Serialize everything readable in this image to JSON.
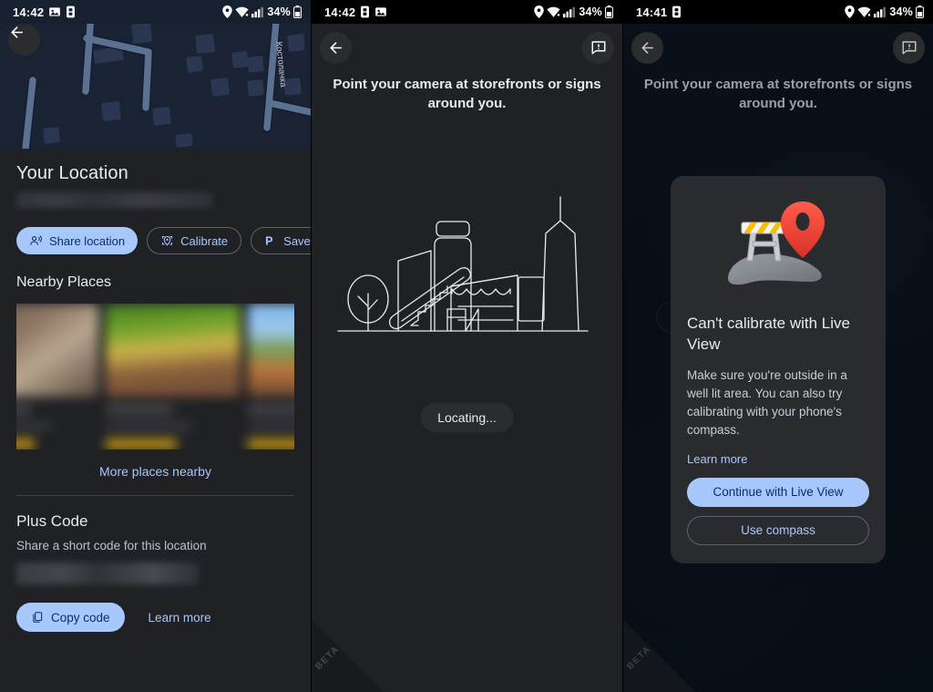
{
  "panels": {
    "location": {
      "status": {
        "time": "14:42",
        "icons": [
          "photo-icon",
          "sim-card-icon",
          "location-pin-icon",
          "wifi-icon",
          "signal-icon",
          "battery-icon"
        ],
        "battery": "34%"
      },
      "map": {
        "street_label": "Костолачка",
        "back_icon": "back-arrow-icon"
      },
      "title": "Your Location",
      "address_redacted": true,
      "chips": [
        {
          "label": "Share location",
          "icon": "share-location-icon",
          "style": "filled"
        },
        {
          "label": "Calibrate",
          "icon": "calibrate-compass-icon",
          "style": "outline"
        },
        {
          "label": "Save parl",
          "icon": "parking-p-icon",
          "style": "outline"
        }
      ],
      "nearby_title": "Nearby Places",
      "nearby_cards": [
        {
          "redacted": true,
          "has_rating": true
        },
        {
          "redacted": true,
          "has_rating": true
        },
        {
          "redacted": true,
          "has_rating": true
        }
      ],
      "more_link": "More places nearby",
      "plus_code": {
        "title": "Plus Code",
        "subtitle": "Share a short code for this location",
        "code_redacted": true,
        "copy_label": "Copy code",
        "copy_icon": "copy-icon",
        "learn_more": "Learn more"
      }
    },
    "live_view": {
      "status": {
        "time": "14:42",
        "battery": "34%"
      },
      "back_icon": "back-arrow-icon",
      "feedback_icon": "feedback-icon",
      "hint": "Point your camera at storefronts or signs around you.",
      "illustration": "city-street-line-art",
      "locating_label": "Locating...",
      "watermark": "BETA"
    },
    "calibrate_dialog": {
      "status": {
        "time": "14:41",
        "battery": "34%"
      },
      "back_icon": "back-arrow-icon",
      "feedback_icon": "feedback-icon",
      "hint": "Point your camera at storefronts or signs around you.",
      "dialog": {
        "illustration": "road-closed-pin-illustration",
        "title": "Can't calibrate with Live View",
        "body": "Make sure you're outside in a well lit area. You can also try calibrating with your phone's compass.",
        "learn_more": "Learn more",
        "primary_button": "Continue with Live View",
        "secondary_button": "Use compass"
      },
      "watermark": "BETA"
    }
  },
  "colors": {
    "accent_blue": "#a8c7fa",
    "surface": "#202124",
    "dialog_surface": "#2a2b2e",
    "map_background": "#1a2333",
    "map_road": "#5a7191",
    "pin_red": "#ea4335",
    "rating_yellow": "#d6a514"
  }
}
